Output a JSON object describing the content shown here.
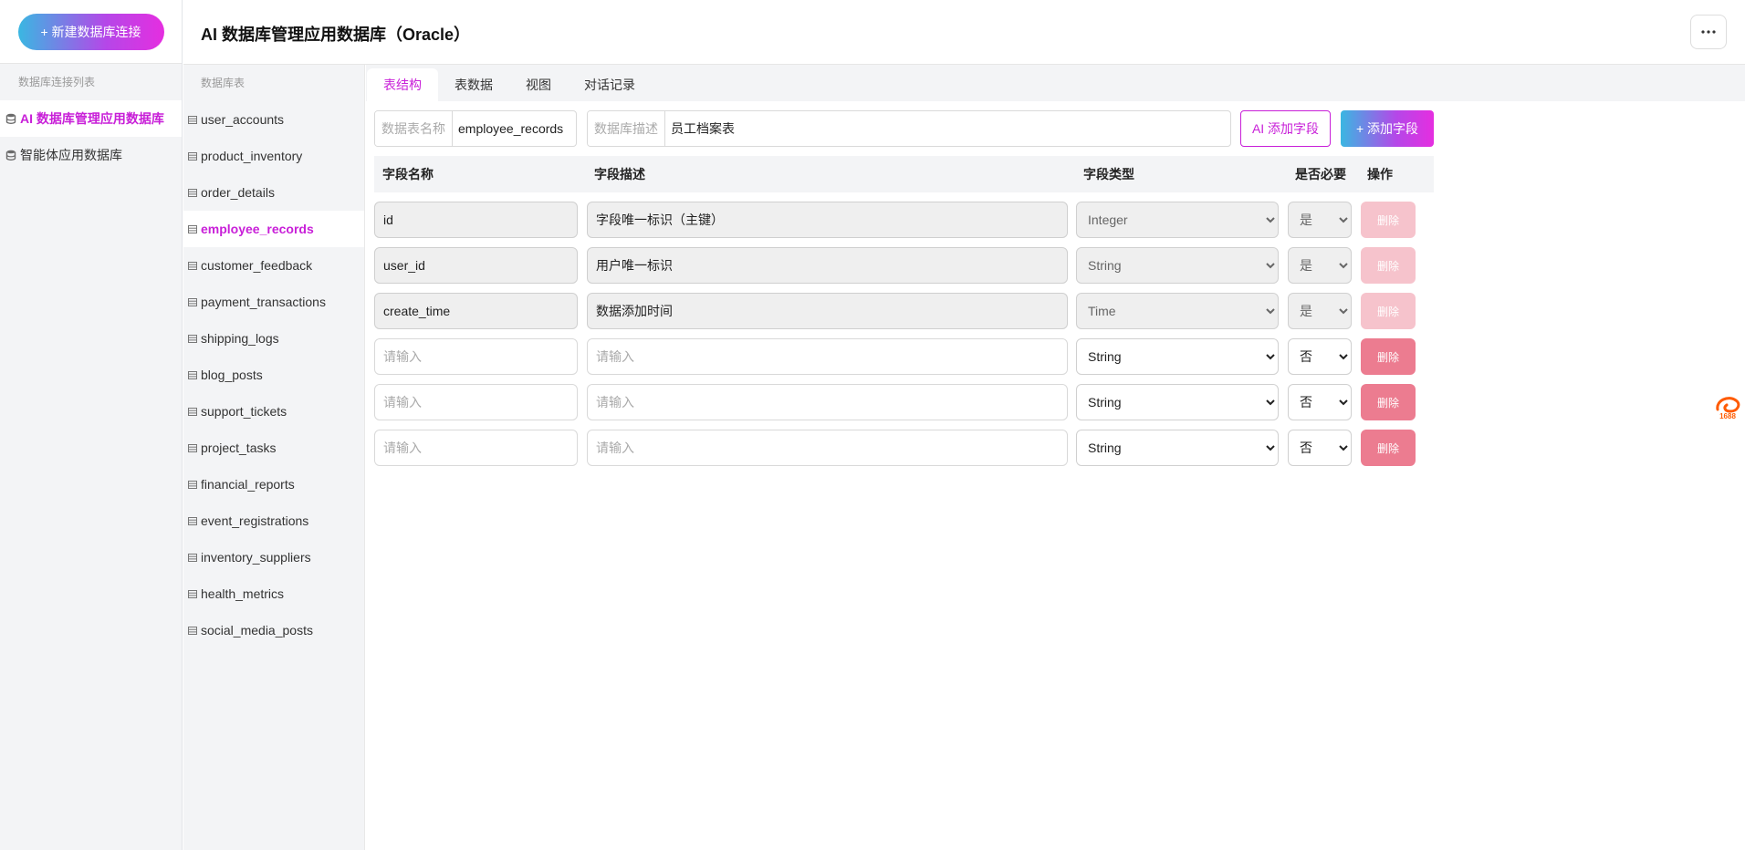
{
  "sidebar": {
    "new_connection_label": "+ 新建数据库连接",
    "section_label": "数据库连接列表",
    "connections": [
      {
        "label": "AI 数据库管理应用数据库",
        "active": true
      },
      {
        "label": "智能体应用数据库",
        "active": false
      }
    ]
  },
  "header": {
    "title": "AI 数据库管理应用数据库（Oracle）",
    "more_label": "···"
  },
  "tables": {
    "section_label": "数据库表",
    "items": [
      "user_accounts",
      "product_inventory",
      "order_details",
      "employee_records",
      "customer_feedback",
      "payment_transactions",
      "shipping_logs",
      "blog_posts",
      "support_tickets",
      "project_tasks",
      "financial_reports",
      "event_registrations",
      "inventory_suppliers",
      "health_metrics",
      "social_media_posts"
    ],
    "active": "employee_records"
  },
  "tabs": [
    "表结构",
    "表数据",
    "视图",
    "对话记录"
  ],
  "toolbar": {
    "table_name_label": "数据表名称",
    "table_name_value": "employee_records",
    "table_desc_label": "数据库描述",
    "table_desc_value": "员工档案表",
    "ai_add_label": "AI 添加字段",
    "add_label": "+ 添加字段"
  },
  "field_table": {
    "headers": {
      "name": "字段名称",
      "desc": "字段描述",
      "type": "字段类型",
      "required": "是否必要",
      "action": "操作"
    },
    "placeholder": "请输入",
    "delete_label": "删除",
    "rows": [
      {
        "name": "id",
        "desc": "字段唯一标识（主键）",
        "type": "Integer",
        "required": "是",
        "readonly": true
      },
      {
        "name": "user_id",
        "desc": "用户唯一标识",
        "type": "String",
        "required": "是",
        "readonly": true
      },
      {
        "name": "create_time",
        "desc": "数据添加时间",
        "type": "Time",
        "required": "是",
        "readonly": true
      },
      {
        "name": "",
        "desc": "",
        "type": "String",
        "required": "否",
        "readonly": false
      },
      {
        "name": "",
        "desc": "",
        "type": "String",
        "required": "否",
        "readonly": false
      },
      {
        "name": "",
        "desc": "",
        "type": "String",
        "required": "否",
        "readonly": false
      }
    ]
  },
  "float_widget": {
    "label": "1688"
  },
  "colors": {
    "accent": "#c81fd8",
    "gradient_start": "#3ab7e2",
    "gradient_end": "#e52ee0",
    "delete": "#ec7c90"
  }
}
